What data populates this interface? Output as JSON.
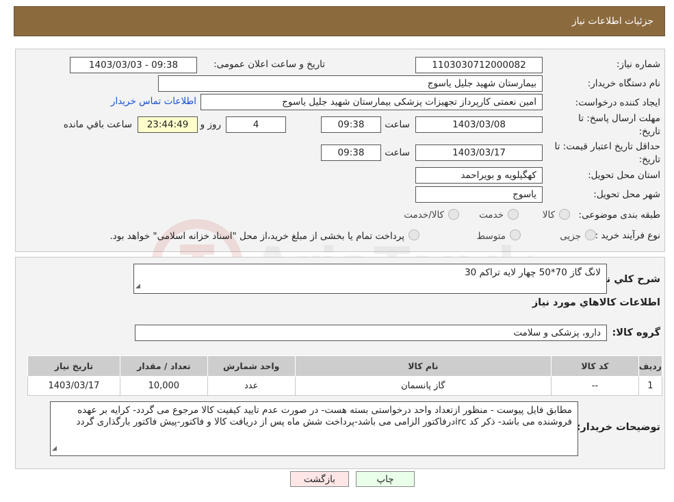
{
  "header": {
    "title": "جزئیات اطلاعات نیاز"
  },
  "fields": {
    "need_number_label": "شماره نیاز:",
    "need_number": "1103030712000082",
    "announce_label": "تاریخ و ساعت اعلان عمومی:",
    "announce_value": "1403/03/03 - 09:38",
    "buyer_label": "نام دستگاه خریدار:",
    "buyer_value": "بیمارستان شهید جلیل یاسوج",
    "creator_label": "ایجاد کننده درخواست:",
    "creator_value": "امین نعمتی کارپرداز تجهیزات پزشکی بیمارستان شهید جلیل یاسوج",
    "contact_link": "اطلاعات تماس خریدار",
    "deadline_label_1": "مهلت ارسال پاسخ: تا",
    "deadline_label_2": "تاریخ:",
    "deadline_date": "1403/03/08",
    "time_label": "ساعت",
    "deadline_time": "09:38",
    "days_value": "4",
    "days_label": "روز و",
    "remaining_time": "23:44:49",
    "remaining_label": "ساعت باقي مانده",
    "validity_label_1": "حداقل تاریخ اعتبار قیمت: تا",
    "validity_label_2": "تاریخ:",
    "validity_date": "1403/03/17",
    "validity_time": "09:38",
    "province_label": "استان محل تحویل:",
    "province_value": "کهگیلویه و بویراحمد",
    "city_label": "شهر محل تحویل:",
    "city_value": "یاسوج",
    "category_label": "طبقه بندی موضوعی:",
    "category_options": [
      "کالا",
      "خدمت",
      "کالا/خدمت"
    ],
    "process_label": "نوع فرآیند خرید :",
    "process_options": [
      "جزیی",
      "متوسط"
    ],
    "process_note": "پرداخت تمام یا بخشی از مبلغ خرید،از محل \"اسناد خزانه اسلامی\" خواهد بود."
  },
  "summary": {
    "desc_label": "شرح کلي نياز:",
    "desc_value": "لانگ گاز 70*50 چهار لایه تراکم 30",
    "items_heading": "اطلاعات کالاهاي مورد نياز",
    "group_label": "گروه کالا:",
    "group_value": "دارو، پزشکی و سلامت"
  },
  "table": {
    "headers": [
      "رديف",
      "کد کالا",
      "نام کالا",
      "واحد شمارش",
      "تعداد / مقدار",
      "تاریخ نیاز"
    ],
    "rows": [
      [
        "1",
        "--",
        "گاز پانسمان",
        "عدد",
        "10,000",
        "1403/03/17"
      ]
    ]
  },
  "notes": {
    "label": "توضیحات خریدار:",
    "text": "مطابق فایل پیوست - منظور ازتعداد واحد درخواستی بسته هست- در صورت عدم تایید کیفیت کالا مرجوع می گردد- کرایه بر عهده فروشنده می باشد- ذکر کد ircدرفاکتور الزامی می باشد-پرداخت شش ماه پس از دریافت کالا و فاکتور-پیش فاکتور بارگذاری گردد"
  },
  "buttons": {
    "print": "چاپ",
    "back": "بازگشت"
  }
}
